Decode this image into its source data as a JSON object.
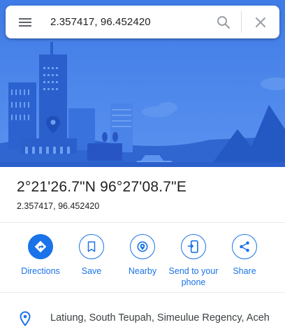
{
  "search": {
    "query": "2.357417, 96.452420"
  },
  "place": {
    "title": "2°21'26.7\"N 96°27'08.7\"E",
    "subtitle": "2.357417, 96.452420"
  },
  "actions": [
    {
      "label": "Directions",
      "icon": "directions-icon"
    },
    {
      "label": "Save",
      "icon": "bookmark-icon"
    },
    {
      "label": "Nearby",
      "icon": "nearby-icon"
    },
    {
      "label": "Send to your phone",
      "icon": "send-to-phone-icon"
    },
    {
      "label": "Share",
      "icon": "share-icon"
    }
  ],
  "address": {
    "text": "Latiung, South Teupah, Simeulue Regency, Aceh",
    "icon": "location-pin-icon"
  },
  "colors": {
    "accent": "#1a73e8",
    "hero_sky": "#3b78e7"
  }
}
